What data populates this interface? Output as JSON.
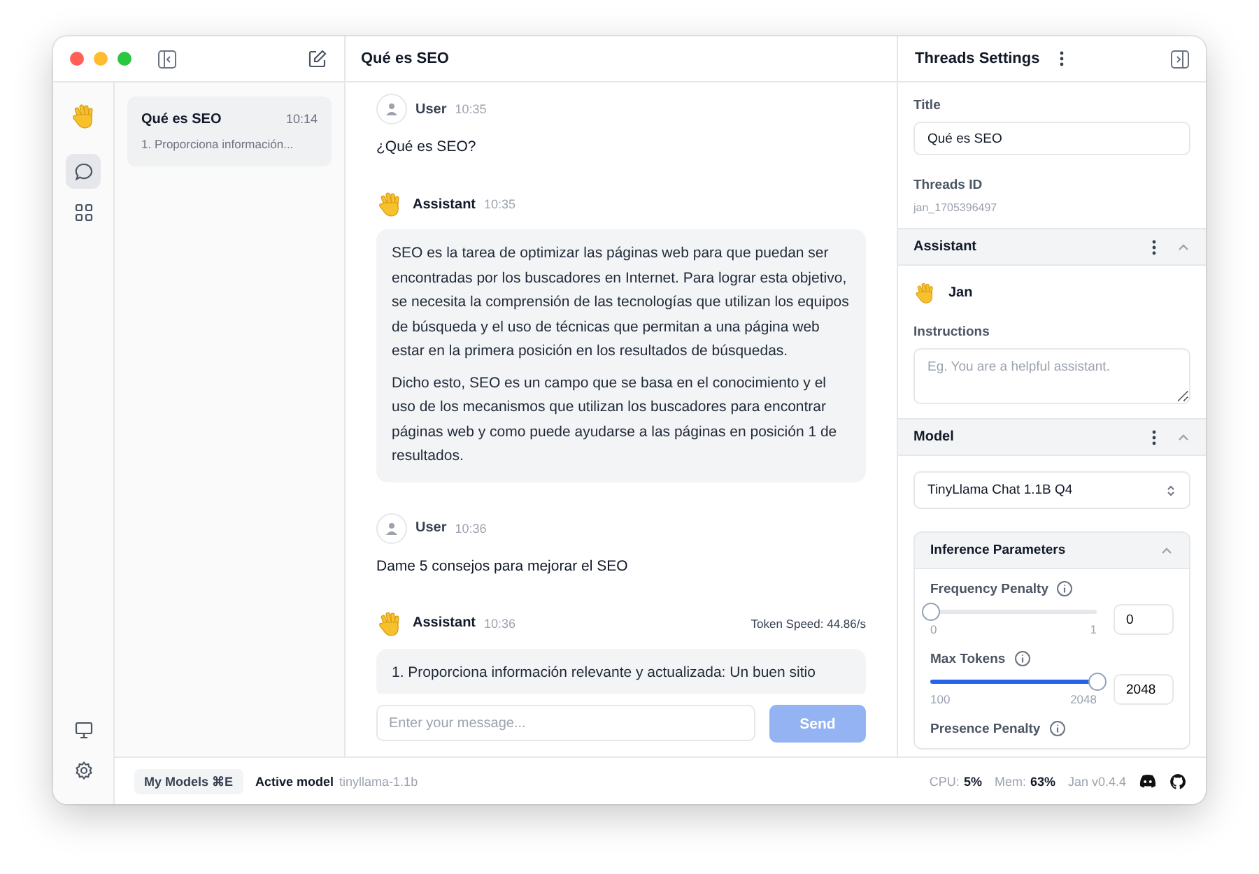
{
  "nav_rail": {
    "items": [
      {
        "kind": "chat",
        "selected": true
      },
      {
        "kind": "hub",
        "selected": false
      }
    ],
    "bottom_items": [
      {
        "kind": "monitor"
      },
      {
        "kind": "settings"
      }
    ]
  },
  "thread_list": [
    {
      "title": "Qué es SEO",
      "time": "10:14",
      "preview": "1. Proporciona información...",
      "selected": true
    }
  ],
  "chat": {
    "title": "Qué es SEO",
    "messages": [
      {
        "kind": "user",
        "author": "User",
        "time": "10:35",
        "paragraphs": [
          "¿Qué es SEO?"
        ]
      },
      {
        "kind": "assistant",
        "author": "Assistant",
        "time": "10:35",
        "paragraphs": [
          "SEO es la tarea de optimizar las páginas web para que puedan ser encontradas por los buscadores en Internet. Para lograr esta objetivo, se necesita la comprensión de las tecnologías que utilizan los equipos de búsqueda y el uso de técnicas que permitan a una página web estar en la primera posición en los resultados de búsquedas.",
          "Dicho esto, SEO es un campo que se basa en el conocimiento y el uso de los mecanismos que utilizan los buscadores para encontrar páginas web y como puede ayudarse a las páginas en posición 1 de resultados."
        ]
      },
      {
        "kind": "user",
        "author": "User",
        "time": "10:36",
        "paragraphs": [
          "Dame 5 consejos para mejorar el SEO"
        ]
      },
      {
        "kind": "assistant",
        "author": "Assistant",
        "time": "10:36",
        "token_speed": "Token Speed: 44.86/s",
        "paragraphs": [
          "1. Proporciona información relevante y actualizada: Un buen sitio"
        ]
      }
    ],
    "input": {
      "placeholder": "Enter your message..."
    },
    "send_button": {
      "label": "Send",
      "disabled": true
    }
  },
  "settings_panel": {
    "title": "Threads Settings",
    "title_field": {
      "label": "Title",
      "value": "Qué es SEO"
    },
    "thread_id": {
      "label": "Threads ID",
      "value": "jan_1705396497"
    },
    "assistant": {
      "heading": "Assistant",
      "expanded": true,
      "name": "Jan",
      "instructions_label": "Instructions",
      "instructions_placeholder": "Eg. You are a helpful assistant."
    },
    "model": {
      "heading": "Model",
      "expanded": true,
      "selected_model": "TinyLlama Chat 1.1B Q4"
    },
    "inference": {
      "heading": "Inference Parameters",
      "expanded": true,
      "params": [
        {
          "label": "Frequency Penalty",
          "min": "0",
          "max": "1",
          "value": "0",
          "level": 0
        },
        {
          "label": "Max Tokens",
          "min": "100",
          "max": "2048",
          "value": "2048",
          "level": 1
        },
        {
          "label": "Presence Penalty"
        }
      ]
    }
  },
  "status_bar": {
    "my_models": "My Models ⌘E",
    "active_model_label": "Active model",
    "active_model": "tinyllama-1.1b",
    "cpu_label": "CPU:",
    "cpu": "5%",
    "mem_label": "Mem:",
    "mem": "63%",
    "version": "Jan v0.4.4"
  }
}
